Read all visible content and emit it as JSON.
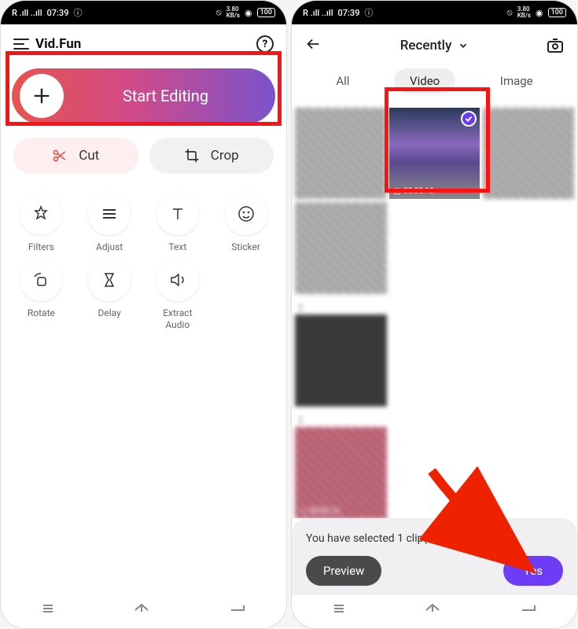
{
  "status_bar": {
    "time": "07:39",
    "signal": "R .ıll ..ıll",
    "battery": "100"
  },
  "left_screen": {
    "app_name": "Vid.Fun",
    "start_editing_label": "Start Editing",
    "cut_label": "Cut",
    "crop_label": "Crop",
    "tools": [
      {
        "label": "Filters"
      },
      {
        "label": "Adjust"
      },
      {
        "label": "Text"
      },
      {
        "label": "Sticker"
      },
      {
        "label": "Rotate"
      },
      {
        "label": "Delay"
      },
      {
        "label": "Extract\nAudio"
      }
    ]
  },
  "right_screen": {
    "folder_label": "Recently",
    "tabs": [
      {
        "label": "All"
      },
      {
        "label": "Video"
      },
      {
        "label": "Image"
      }
    ],
    "active_tab": "Video",
    "selected_duration": "00:00:13",
    "last_duration": "00:00:16",
    "selection_text": "You have selected 1 clip(s) (u",
    "selection_text_end": ").",
    "preview_label": "Preview",
    "yes_label": "Yes"
  }
}
